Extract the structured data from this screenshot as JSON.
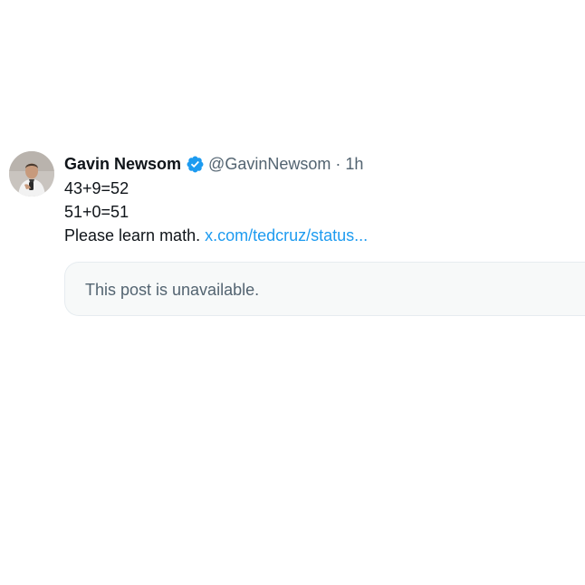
{
  "tweet": {
    "author_name": "Gavin Newsom",
    "verified_icon": "verified-badge-icon",
    "handle": "@GavinNewsom",
    "separator": "·",
    "time": "1h",
    "lines": [
      "43+9=52",
      "51+0=51"
    ],
    "closing_text": "Please learn math.",
    "link_text": "x.com/tedcruz/status..."
  },
  "quote": {
    "text": "This post is unavailable."
  },
  "colors": {
    "link": "#1d9bf0",
    "secondary_text": "#536471",
    "verified": "#1d9bf0",
    "quote_background": "#f7f9f9"
  }
}
